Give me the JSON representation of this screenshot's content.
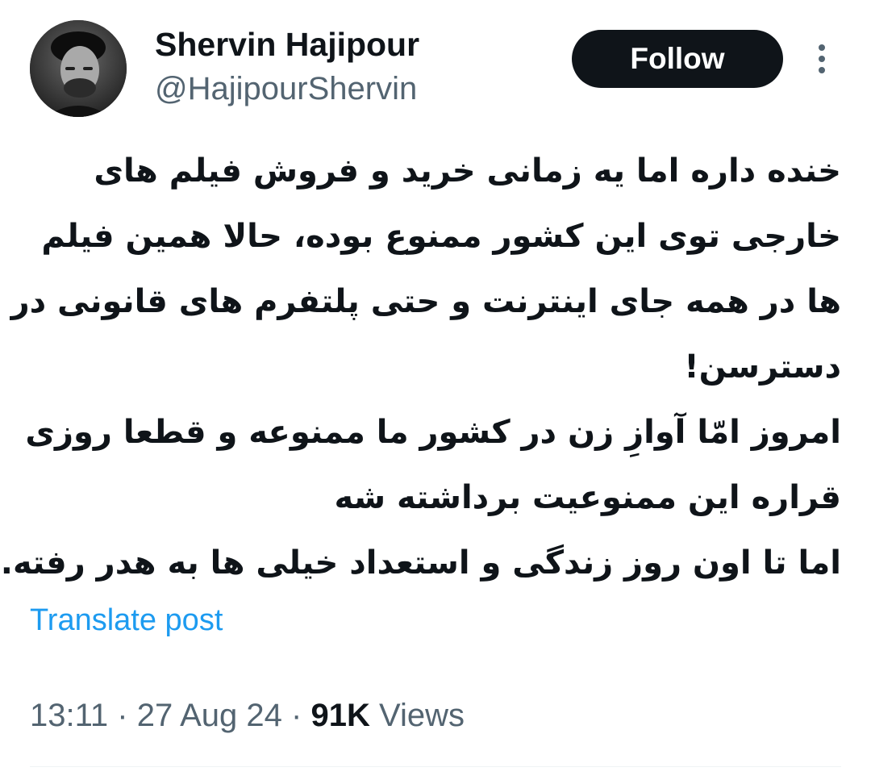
{
  "author": {
    "display_name": "Shervin Hajipour",
    "handle": "@HajipourShervin",
    "avatar_icon": "profile-photo"
  },
  "actions": {
    "follow_label": "Follow",
    "more_icon": "vertical-dots-icon"
  },
  "tweet": {
    "lines": [
      "خنده داره اما یه زمانی خرید و فروش فیلم های",
      "خارجی توی این کشور ممنوع بوده، حالا همین فیلم",
      "ها در همه جای اینترنت و حتی پلتفرم های قانونی در",
      "دسترسن!",
      "امروز امّا آوازِ زن در کشور ما ممنوعه و قطعا روزی",
      "قراره این ممنوعیت برداشته شه",
      "اما تا اون روز زندگی و استعداد خیلی ها به هدر رفته."
    ],
    "translate_label": "Translate post"
  },
  "meta": {
    "time": "13:11",
    "separator": "·",
    "date": "27 Aug 24",
    "views_count": "91K",
    "views_label": "Views"
  },
  "colors": {
    "text_primary": "#0f1419",
    "text_secondary": "#536471",
    "link": "#1d9bf0",
    "follow_bg": "#0f1419",
    "divider": "#eff3f4"
  }
}
